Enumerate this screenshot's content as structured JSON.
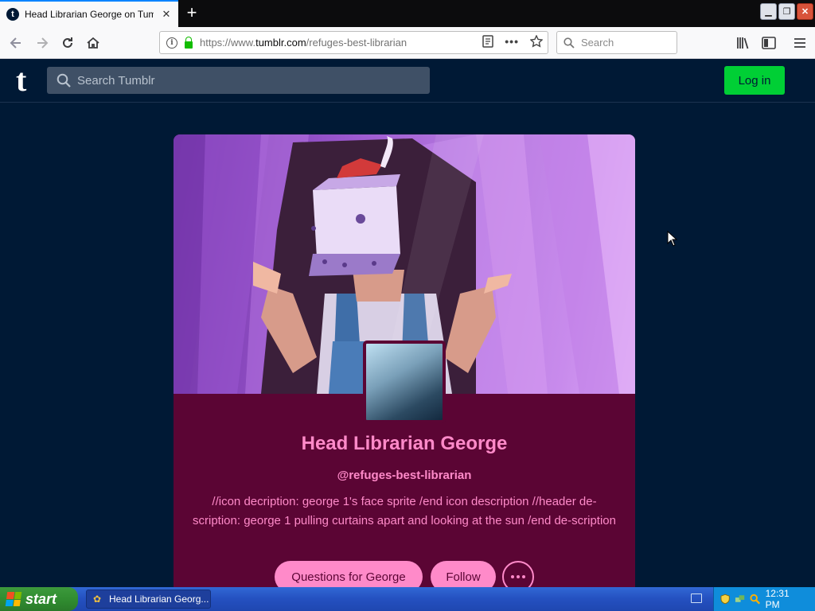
{
  "browser": {
    "tab_title": "Head Librarian George on Tumblr",
    "tab_favicon": "t",
    "new_tab_symbol": "+",
    "url_prefix": "https://www.",
    "url_domain": "tumblr.com",
    "url_path": "/refuges-best-librarian",
    "search_placeholder": "Search"
  },
  "tumblr": {
    "logo": "t",
    "search_placeholder": "Search Tumblr",
    "login_label": "Log in"
  },
  "blog": {
    "title": "Head Librarian George",
    "handle": "@refuges-best-librarian",
    "description": "//icon decription: george 1's face sprite /end icon description //header de-scription: george 1 pulling curtains apart and looking at the sun /end de-scription",
    "questions_button": "Questions for George",
    "follow_button": "Follow",
    "accent_color": "#ff8ac9",
    "background_color": "#5b0534"
  },
  "taskbar": {
    "start_label": "start",
    "task_item_label": "Head Librarian Georg...",
    "clock": "12:31 PM"
  },
  "colors": {
    "tumblr_navy": "#001935",
    "login_green": "#00cf35"
  }
}
